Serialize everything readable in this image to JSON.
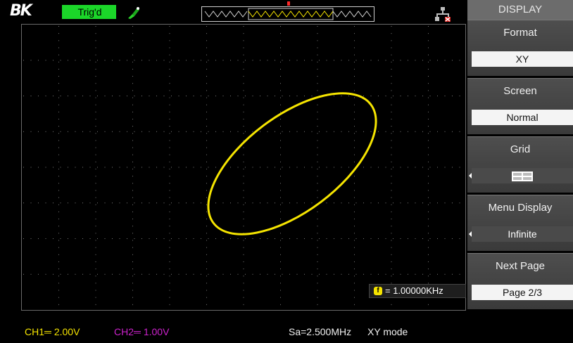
{
  "header": {
    "logo": "BK",
    "trigger_status": "Trig'd",
    "probe_icon": "probe-icon",
    "usb_icon": "usb-icon"
  },
  "measurement": {
    "frequency": "= 1.00000KHz",
    "icon_label": "f"
  },
  "status_bar": {
    "ch1": "CH1═ 2.00V",
    "ch2": "CH2═ 1.00V",
    "sample_rate": "Sa=2.500MHz",
    "mode": "XY mode"
  },
  "menu": {
    "title": "DISPLAY",
    "items": [
      {
        "label": "Format",
        "value": "XY"
      },
      {
        "label": "Screen",
        "value": "Normal"
      },
      {
        "label": "Grid",
        "value": "grid-full-icon"
      },
      {
        "label": "Menu Display",
        "value": "Infinite"
      },
      {
        "label": "Next Page",
        "value": "Page 2/3"
      }
    ]
  },
  "colors": {
    "ch1": "#f5e400",
    "ch2": "#cc22cc",
    "trigger": "#1bd629",
    "trace": "#f5e400"
  }
}
